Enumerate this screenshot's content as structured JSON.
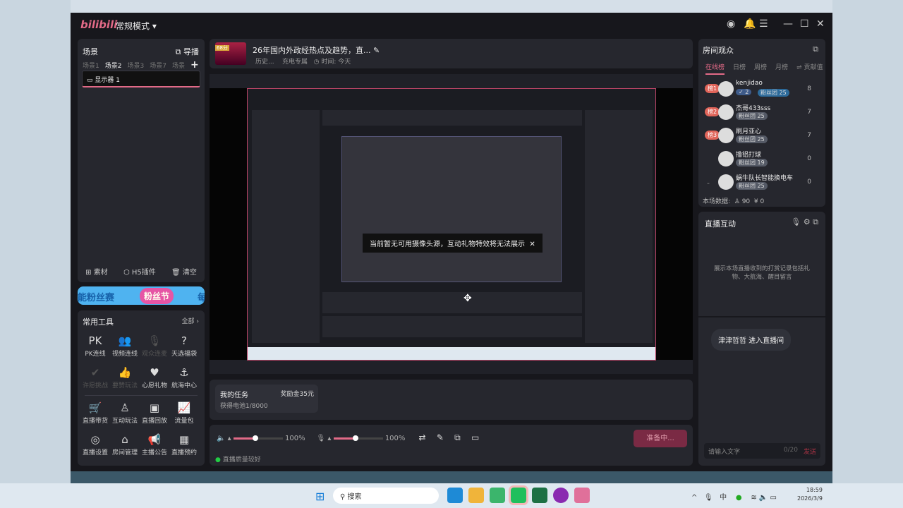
{
  "app": {
    "logo": "bilibili",
    "mode": "常规模式 ▾"
  },
  "scenes": {
    "title": "场景",
    "director": "导播",
    "tabs": [
      "场景1",
      "场景2",
      "场景3",
      "场景7",
      "场景"
    ],
    "active": 1,
    "source": "显示器 1",
    "footer": [
      "素材",
      "H5插件",
      "清空"
    ]
  },
  "banner": {
    "left": "能粉丝赛",
    "center": "粉丝节",
    "right": "每"
  },
  "tools": {
    "title": "常用工具",
    "all": "全部 ›",
    "items": [
      {
        "label": "PK连线",
        "icon": "PK",
        "disabled": false
      },
      {
        "label": "视频连线",
        "icon": "👥",
        "disabled": false
      },
      {
        "label": "观众连麦",
        "icon": "🎙",
        "disabled": true
      },
      {
        "label": "天选福袋",
        "icon": "?",
        "disabled": false
      },
      {
        "label": "许愿挑战",
        "icon": "✔",
        "disabled": true
      },
      {
        "label": "要赞玩法",
        "icon": "👍",
        "disabled": true
      },
      {
        "label": "心愿礼物",
        "icon": "♥",
        "disabled": false
      },
      {
        "label": "航海中心",
        "icon": "⚓",
        "disabled": false
      },
      {
        "label": "直播带货",
        "icon": "🛒",
        "disabled": false
      },
      {
        "label": "互动玩法",
        "icon": "♙",
        "disabled": false
      },
      {
        "label": "直播回放",
        "icon": "▣",
        "disabled": false
      },
      {
        "label": "流量包",
        "icon": "📈",
        "disabled": false
      },
      {
        "label": "直播设置",
        "icon": "◎",
        "disabled": false
      },
      {
        "label": "房间管理",
        "icon": "⌂",
        "disabled": false
      },
      {
        "label": "主播公告",
        "icon": "📢",
        "disabled": false
      },
      {
        "label": "直播预约",
        "icon": "▦",
        "disabled": false
      }
    ]
  },
  "stream": {
    "title": "26年国内外政经热点及趋势，直...",
    "history": "历史...",
    "charge": "充电专属",
    "time": "时间: 今天",
    "thumb_badge": "68分"
  },
  "preview": {
    "notice": "当前暂无可用摄像头源，互动礼物特效将无法展示"
  },
  "task": {
    "title": "我的任务",
    "reward": "奖励金35元",
    "progress": "获得电池1/8000"
  },
  "controls": {
    "speaker_volume": "100%",
    "mic_volume": "100%",
    "speaker_level": 0.45,
    "mic_level": 0.45,
    "start": "准备中...",
    "quality": "直播质量较好"
  },
  "audience": {
    "title": "房间观众",
    "tabs": [
      "在线榜",
      "日榜",
      "周榜",
      "月榜",
      "⇌ 贡献值"
    ],
    "users": [
      {
        "rank": "榜1",
        "name": "kenjidao",
        "medal": "粉丝团 25",
        "level": "2",
        "count": "8"
      },
      {
        "rank": "榜2",
        "name": "杰哥433sss",
        "medal": "粉丝团 25",
        "count": "7"
      },
      {
        "rank": "榜3",
        "name": "刷月亚心",
        "medal": "粉丝团 25",
        "count": "7"
      },
      {
        "rank": "",
        "name": "撸铝打球",
        "medal": "粉丝团 19",
        "count": "0"
      },
      {
        "rank": "-",
        "name": "蜗牛队长智能换电车",
        "medal": "粉丝团 25",
        "count": "0"
      }
    ],
    "stats_label": "本场数据:",
    "viewers": "90",
    "gold": "0"
  },
  "interaction": {
    "title": "直播互动",
    "empty": "展示本场直播收到的打赏记录包括礼物、大航海、醒目留言",
    "entry": "津津哲哲 进入直播间",
    "placeholder": "请输入文字",
    "counter": "0/20",
    "send": "发送"
  },
  "taskbar": {
    "search": "搜索",
    "time": "18:59",
    "date": "2026/3/9",
    "ime": "中"
  }
}
